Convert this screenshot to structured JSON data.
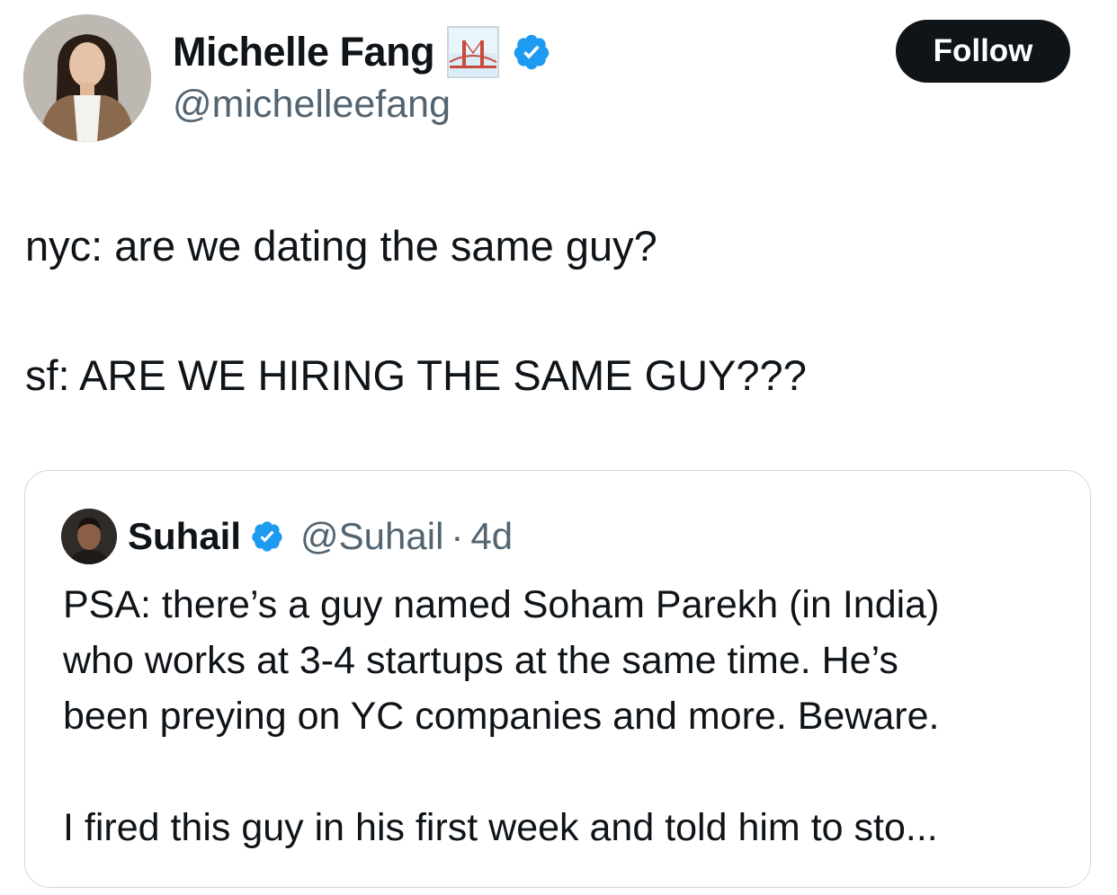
{
  "author": {
    "display_name": "Michelle Fang",
    "handle": "@michelleefang",
    "avatar_icon": "profile-photo",
    "badge_icon": "golden-gate-bridge-emoji",
    "verified_icon": "verified-badge-icon"
  },
  "follow_label": "Follow",
  "tweet": {
    "lines": [
      "nyc: are we dating the same guy?",
      "sf: ARE WE HIRING THE SAME GUY???"
    ]
  },
  "quoted": {
    "display_name": "Suhail",
    "handle": "@Suhail",
    "separator": "·",
    "time": "4d",
    "lines": [
      "PSA: there’s a guy named Soham Parekh (in India)",
      "who works at 3-4 startups at the same time. He’s",
      "been preying on YC companies and more. Beware.",
      "I fired this guy in his first week and told him to sto..."
    ]
  },
  "colors": {
    "text": "#0f1419",
    "secondary": "#536471",
    "verified_blue": "#1d9bf0",
    "follow_bg": "#0f1419",
    "border": "#cfd9de"
  }
}
